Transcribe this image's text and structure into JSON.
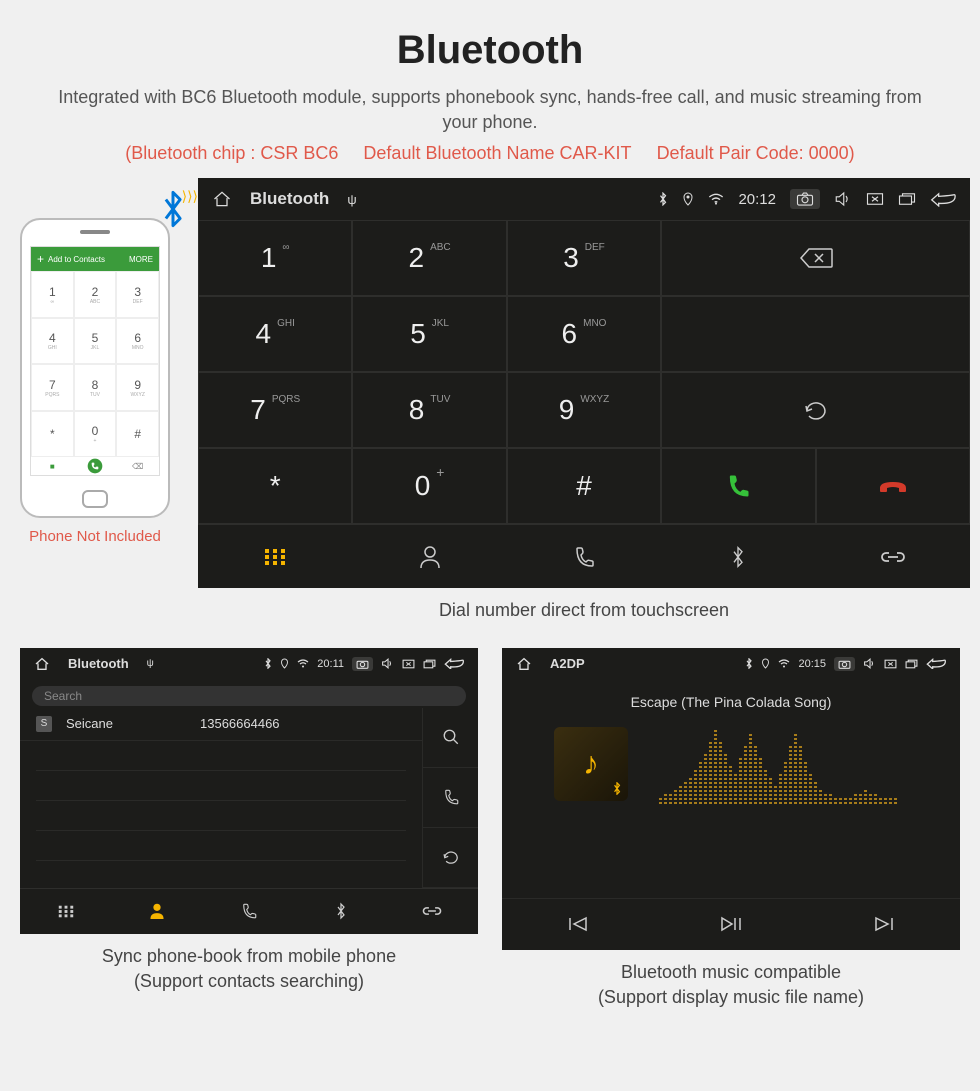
{
  "header": {
    "title": "Bluetooth",
    "description": "Integrated with BC6 Bluetooth module, supports phonebook sync, hands-free call, and music streaming from your phone.",
    "spec_chip": "(Bluetooth chip : CSR BC6",
    "spec_name": "Default Bluetooth Name CAR-KIT",
    "spec_code": "Default Pair Code: 0000)"
  },
  "phone_mock": {
    "top_label": "Add to Contacts",
    "top_more": "MORE",
    "caption": "Phone Not Included"
  },
  "dialer": {
    "statusbar": {
      "title": "Bluetooth",
      "time": "20:12"
    },
    "keys": [
      {
        "n": "1",
        "s": "∞"
      },
      {
        "n": "2",
        "s": "ABC"
      },
      {
        "n": "3",
        "s": "DEF"
      },
      {
        "n": "4",
        "s": "GHI"
      },
      {
        "n": "5",
        "s": "JKL"
      },
      {
        "n": "6",
        "s": "MNO"
      },
      {
        "n": "7",
        "s": "PQRS"
      },
      {
        "n": "8",
        "s": "TUV"
      },
      {
        "n": "9",
        "s": "WXYZ"
      },
      {
        "n": "*",
        "s": ""
      },
      {
        "n": "0",
        "s": "+"
      },
      {
        "n": "#",
        "s": ""
      }
    ],
    "caption": "Dial number direct from touchscreen"
  },
  "phonebook": {
    "statusbar": {
      "title": "Bluetooth",
      "time": "20:11"
    },
    "search_placeholder": "Search",
    "contact_badge": "S",
    "contact_name": "Seicane",
    "contact_number": "13566664466",
    "caption_line1": "Sync phone-book from mobile phone",
    "caption_line2": "(Support contacts searching)"
  },
  "a2dp": {
    "statusbar": {
      "title": "A2DP",
      "time": "20:15"
    },
    "track": "Escape (The Pina Colada Song)",
    "caption_line1": "Bluetooth music compatible",
    "caption_line2": "(Support display music file name)"
  }
}
